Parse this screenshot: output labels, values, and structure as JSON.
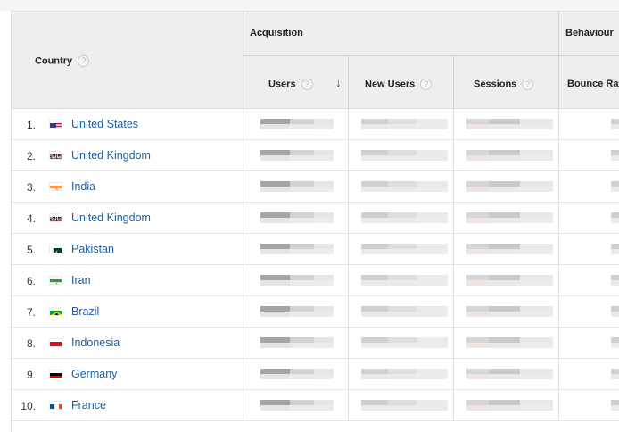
{
  "header": {
    "country_label": "Country",
    "acquisition_label": "Acquisition",
    "behaviour_label": "Behaviour",
    "columns": {
      "users": "Users",
      "new_users": "New Users",
      "sessions": "Sessions",
      "bounce_rate": "Bounce Rate"
    },
    "help_glyph": "?",
    "sort_glyph": "↓"
  },
  "rows": [
    {
      "rank": "1.",
      "country": "United States",
      "flag": "us-flag-icon"
    },
    {
      "rank": "2.",
      "country": "United Kingdom",
      "flag": "uk-flag-icon"
    },
    {
      "rank": "3.",
      "country": "India",
      "flag": "india-flag-icon"
    },
    {
      "rank": "4.",
      "country": "United Kingdom",
      "flag": "uk-flag-icon"
    },
    {
      "rank": "5.",
      "country": "Pakistan",
      "flag": "pakistan-flag-icon"
    },
    {
      "rank": "6.",
      "country": "Iran",
      "flag": "iran-flag-icon"
    },
    {
      "rank": "7.",
      "country": "Brazil",
      "flag": "brazil-flag-icon"
    },
    {
      "rank": "8.",
      "country": "Indonesia",
      "flag": "indonesia-flag-icon"
    },
    {
      "rank": "9.",
      "country": "Germany",
      "flag": "germany-flag-icon"
    },
    {
      "rank": "10.",
      "country": "France",
      "flag": "france-flag-icon"
    }
  ],
  "colors": {
    "link": "#1a5ea8",
    "header_bg": "#eeeeee",
    "blur_dark": "#a9a9a9",
    "blur_light": "#e3e3e3"
  }
}
